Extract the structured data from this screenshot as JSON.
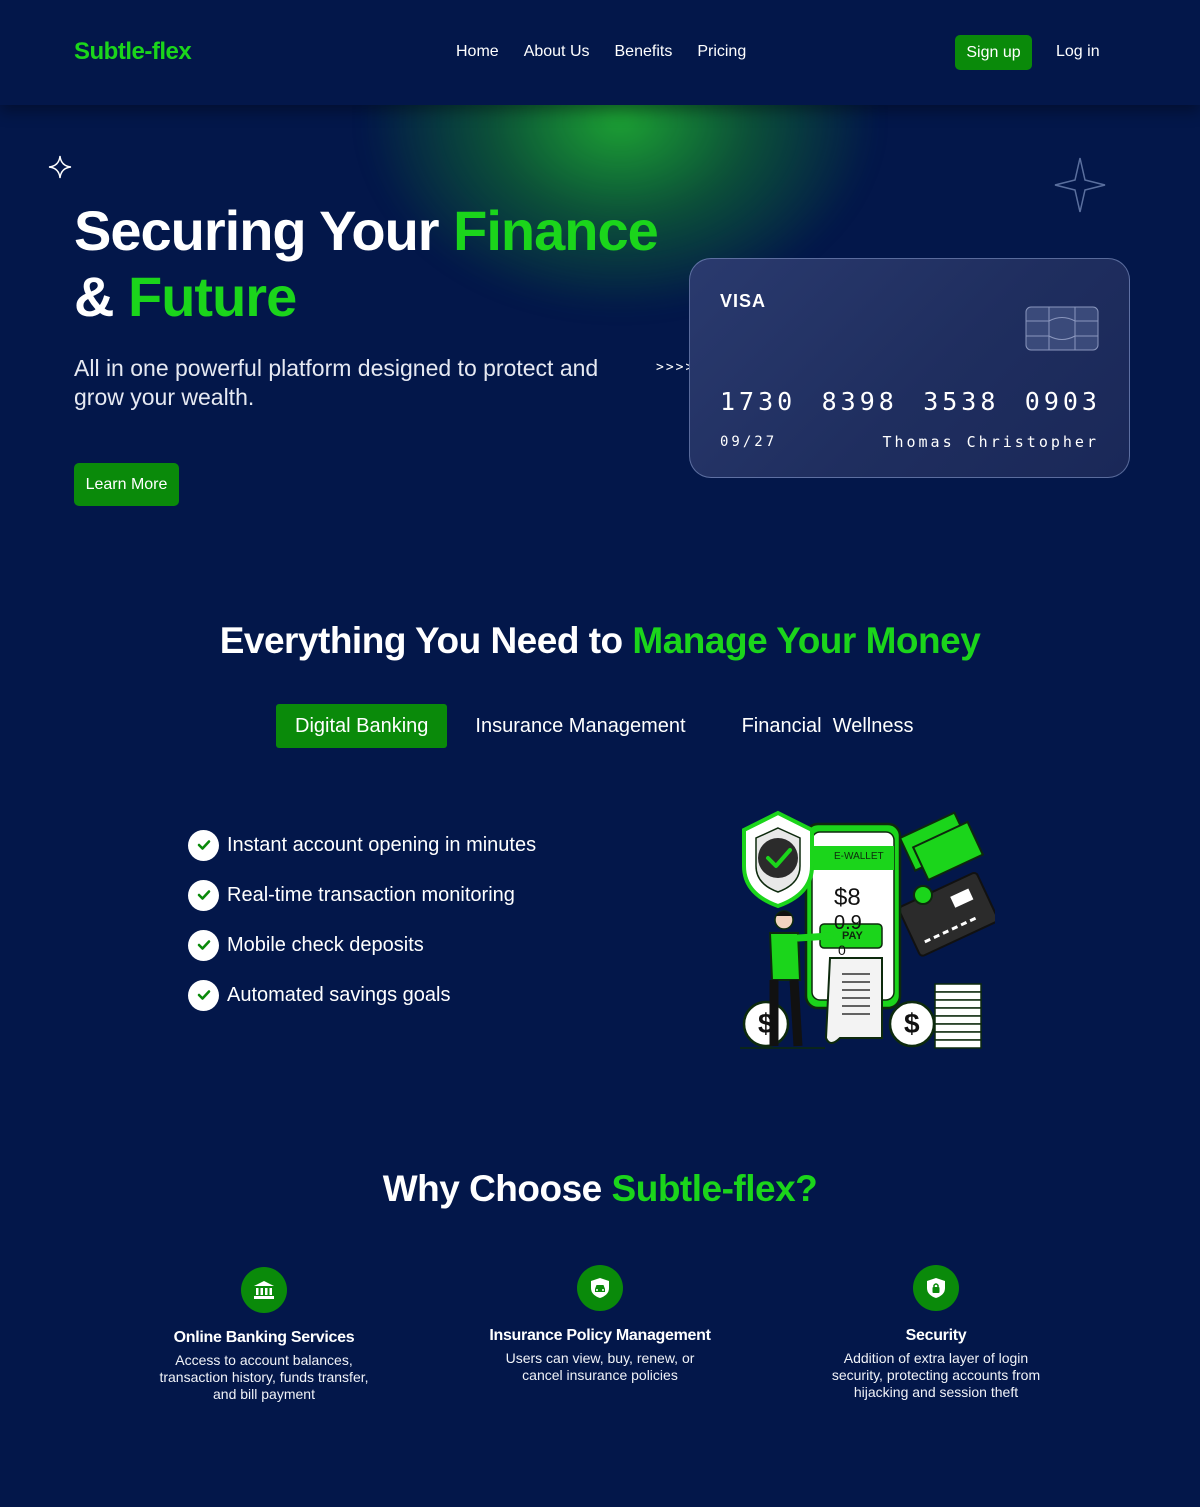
{
  "brand": {
    "logo": "Subtle-flex",
    "accent": "#1bd51b",
    "button_green": "#0a8a0a",
    "background": "#03174a"
  },
  "nav": {
    "links": [
      "Home",
      "About Us",
      "Benefits",
      "Pricing"
    ],
    "signup": "Sign up",
    "login": "Log in"
  },
  "hero": {
    "title_part1": "Securing Your ",
    "title_accent1": "Finance",
    "title_part2": "& ",
    "title_accent2": "Future",
    "subtitle": "All in one powerful platform designed to protect and grow your wealth.",
    "cta": "Learn More",
    "arrows": ">>>>"
  },
  "card": {
    "brand": "VISA",
    "number_groups": [
      "1730",
      "8398",
      "3538",
      "0903"
    ],
    "expiry": "09/27",
    "holder": "Thomas Christopher"
  },
  "manage": {
    "title_part": "Everything You Need to ",
    "title_accent": "Manage Your Money",
    "tabs": [
      "Digital Banking",
      "Insurance Management",
      "Financial  Wellness"
    ],
    "active_tab": "Digital Banking",
    "features": [
      "Instant account opening in minutes",
      "Real-time transaction monitoring",
      "Mobile check deposits",
      "Automated savings goals"
    ],
    "illustration": {
      "wallet_label": "E-WALLET",
      "amount_line1": "$8",
      "amount_line2": "0.9",
      "amount_line3": "0",
      "pay_label": "PAY"
    }
  },
  "why": {
    "title_part": "Why Choose ",
    "title_accent": "Subtle-flex?",
    "items": [
      {
        "icon": "bank-icon",
        "title": "Online Banking Services",
        "desc": "Access to account balances, transaction history, funds transfer, and bill payment"
      },
      {
        "icon": "car-shield-icon",
        "title": "Insurance Policy Management",
        "desc": "Users can view, buy, renew, or cancel insurance policies"
      },
      {
        "icon": "lock-shield-icon",
        "title": "Security",
        "desc": "Addition of extra layer of login security, protecting accounts from hijacking and session theft"
      }
    ]
  }
}
